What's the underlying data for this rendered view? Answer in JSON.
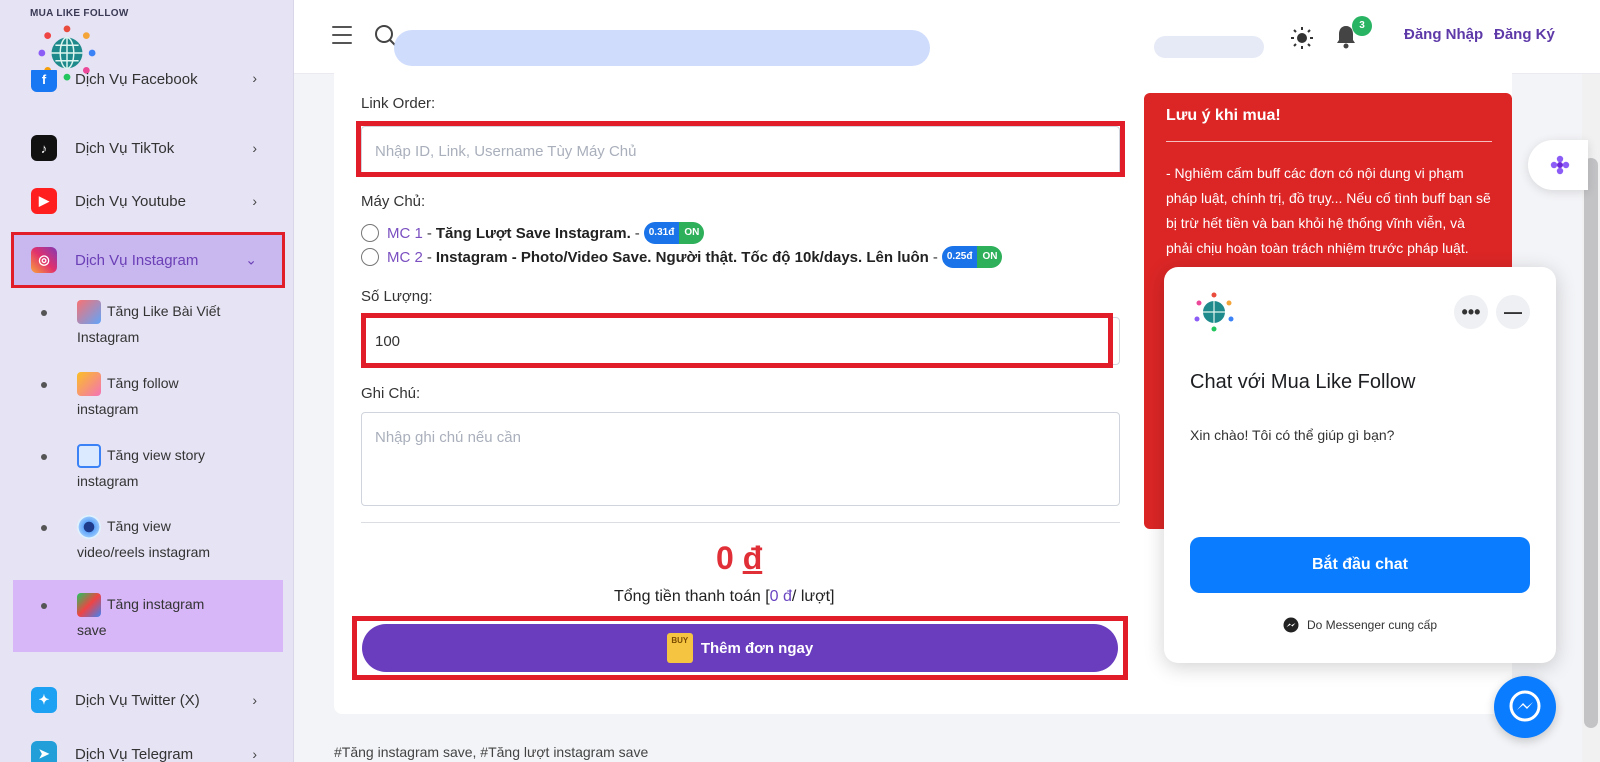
{
  "brand": {
    "name": "MUA LIKE FOLLOW"
  },
  "sidebar": {
    "partial_item": "Dịch Vụ Facebook",
    "items": [
      {
        "label": "Dịch Vụ TikTok",
        "icon": "tiktok-icon"
      },
      {
        "label": "Dịch Vụ Youtube",
        "icon": "youtube-icon"
      },
      {
        "label": "Dịch Vụ Instagram",
        "icon": "instagram-icon"
      },
      {
        "label": "Dịch Vụ Twitter (X)",
        "icon": "twitter-icon"
      },
      {
        "label": "Dịch Vụ Telegram",
        "icon": "telegram-icon"
      }
    ],
    "sub_items": [
      {
        "line1": "Tăng Like Bài Viết",
        "line2": "Instagram"
      },
      {
        "line1": "Tăng follow",
        "line2": "instagram"
      },
      {
        "line1": "Tăng view story",
        "line2": "instagram"
      },
      {
        "line1": "Tăng view",
        "line2": "video/reels instagram"
      },
      {
        "line1": "Tăng instagram",
        "line2": "save"
      }
    ]
  },
  "header": {
    "notification_count": "3",
    "login": "Đăng Nhập",
    "register": "Đăng Ký"
  },
  "form": {
    "link_label": "Link Order:",
    "link_placeholder": "Nhập ID, Link, Username Tùy Máy Chủ",
    "server_label": "Máy Chủ:",
    "servers": [
      {
        "code": "MC 1",
        "sep": "-",
        "desc": "Tăng Lượt Save Instagram.",
        "sep2": "-",
        "price": "0.31đ",
        "status": "ON"
      },
      {
        "code": "MC 2",
        "sep": "-",
        "desc": "Instagram - Photo/Video Save. Người thật. Tốc độ 10k/days. Lên luôn",
        "sep2": "-",
        "price": "0.25đ",
        "status": "ON"
      }
    ],
    "quantity_label": "Số Lượng:",
    "quantity_value": "100",
    "note_label": "Ghi Chú:",
    "note_placeholder": "Nhập ghi chú nếu cần",
    "total_amount": "0",
    "total_currency": "đ",
    "total_text_prefix": "Tổng tiền thanh toán [",
    "total_text_value": "0 đ",
    "total_text_suffix": "/ lượt]",
    "submit_label": "Thêm đơn ngay",
    "buy_icon_text": "BUY"
  },
  "notice": {
    "title": "Lưu ý khi mua!",
    "body": "- Nghiêm cấm buff các đơn có nội dung vi phạm pháp luật, chính trị, đồ trụy... Nếu cố tình buff bạn sẽ bị trừ hết tiền và ban khỏi hệ thống vĩnh viễn, và phải chịu hoàn toàn trách nhiệm trước pháp luật."
  },
  "chat": {
    "title": "Chat với Mua Like Follow",
    "greeting": "Xin chào! Tôi có thể giúp gì bạn?",
    "start_button": "Bắt đầu chat",
    "footer": "Do Messenger cung cấp",
    "more": "•••",
    "minimize": "—"
  },
  "tags": "#Tăng instagram save, #Tăng lượt instagram save",
  "colors": {
    "accent_purple": "#6a3dbf",
    "highlight_red": "#e11d2a",
    "notice_red": "#dc2626",
    "messenger_blue": "#0a7cff"
  }
}
